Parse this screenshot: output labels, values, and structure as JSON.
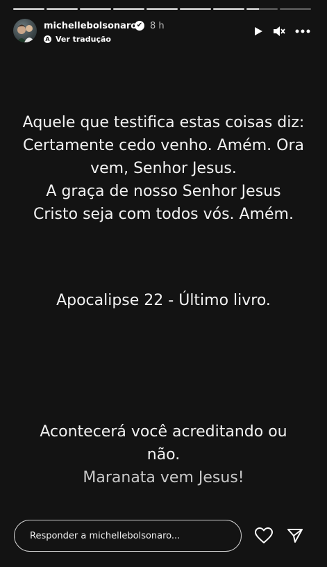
{
  "progress": {
    "total": 9,
    "completed": 8,
    "current_fill": 0.4
  },
  "header": {
    "username": "michellebolsonaro",
    "verified_mark": "✔",
    "time": "8 h",
    "translate_label": "Ver tradução"
  },
  "controls": {
    "play_icon": "play-icon",
    "mute_icon": "speaker-muted-icon",
    "more_icon": "more-options-icon"
  },
  "story": {
    "block1": [
      "Aquele que testifica estas coisas diz:",
      "Certamente cedo venho. Amém. Ora",
      "vem, Senhor Jesus.",
      "A graça de nosso Senhor Jesus",
      "Cristo seja com todos vós. Amém."
    ],
    "block2": [
      "Apocalipse 22 - Último livro."
    ],
    "block3": [
      "Acontecerá você acreditando ou",
      "não.",
      "Maranata vem Jesus!"
    ]
  },
  "reply": {
    "placeholder": "Responder a michellebolsonaro..."
  },
  "colors": {
    "background": "#131313",
    "text": "#f2f2f2",
    "muted_text": "#c9c9c9"
  }
}
